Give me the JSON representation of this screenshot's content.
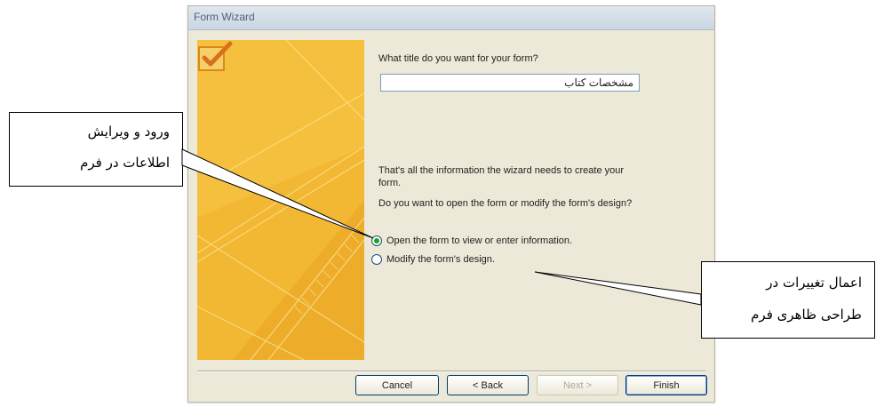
{
  "dialog": {
    "title": "Form Wizard",
    "title_prompt": "What title do you want for your form?",
    "title_value": "مشخصات کتاب",
    "info_line1": "That's all the information the wizard needs to create your",
    "info_line2": "form.",
    "question": "Do you want to open the form or modify the form's design?",
    "options": [
      {
        "label": "Open the form to view or enter information.",
        "selected": true
      },
      {
        "label": "Modify the form's design.",
        "selected": false
      }
    ],
    "buttons": {
      "cancel": "Cancel",
      "back": "< Back",
      "next": "Next >",
      "finish": "Finish"
    },
    "colors": {
      "banner": "#f2b833",
      "check": "#e08a1e",
      "dialog_bg": "#ece9d8"
    }
  },
  "callouts": {
    "left": {
      "line1": "ورود  و  ویرایش",
      "line2": "اطلاعات در فرم"
    },
    "right": {
      "line1": "اعمال  تغییرات  در",
      "line2": "طراحی ظاهری فرم"
    }
  }
}
